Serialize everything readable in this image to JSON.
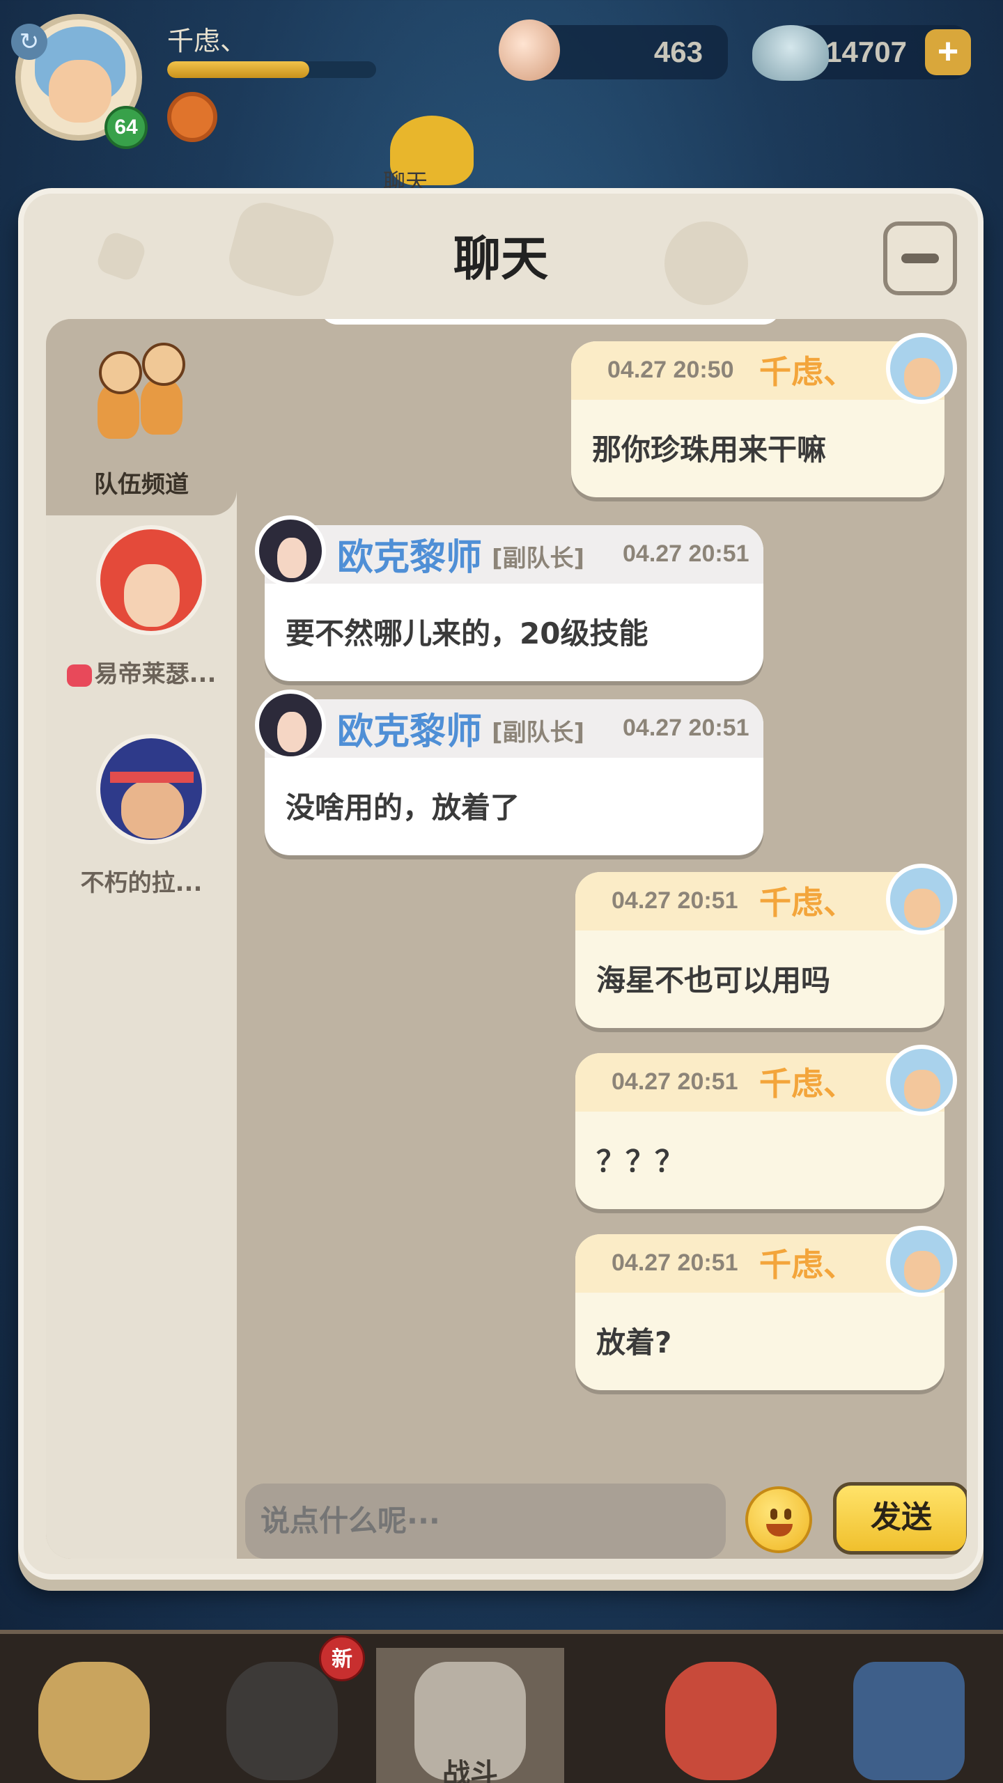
{
  "hud": {
    "player_name": "千虑、",
    "level": "64",
    "xp_progress": 0.68,
    "pearls": "463",
    "shells": "14707",
    "plus_label": "+",
    "background_chat_label": "聊天"
  },
  "chat": {
    "title": "聊天",
    "channels": [
      {
        "label": "队伍频道",
        "active": true,
        "icon": "team-icon"
      },
      {
        "label": "易帝莱瑟...",
        "active": false,
        "icon": "heart-icon"
      },
      {
        "label": "不朽的拉...",
        "active": false,
        "icon": ""
      }
    ],
    "messages": [
      {
        "side": "mine",
        "time": "04.27 20:50",
        "name": "千虑、",
        "text": "那你珍珠用来干嘛"
      },
      {
        "side": "theirs",
        "time": "04.27 20:51",
        "name": "欧克黎师",
        "role": "[副队长]",
        "text": "要不然哪儿来的，20级技能"
      },
      {
        "side": "theirs",
        "time": "04.27 20:51",
        "name": "欧克黎师",
        "role": "[副队长]",
        "text": "没啥用的，放着了"
      },
      {
        "side": "mine",
        "time": "04.27 20:51",
        "name": "千虑、",
        "text": "海星不也可以用吗"
      },
      {
        "side": "mine",
        "time": "04.27 20:51",
        "name": "千虑、",
        "text": "？？？"
      },
      {
        "side": "mine",
        "time": "04.27 20:51",
        "name": "千虑、",
        "text": "放着?"
      }
    ],
    "input_placeholder": "说点什么呢···",
    "send_label": "发送"
  },
  "bottom_nav": {
    "badge_new": "新",
    "battle_label": "战斗"
  },
  "colors": {
    "panel_bg": "#e8e2d5",
    "content_bg": "#beb3a2",
    "my_name": "#f3a53b",
    "their_name": "#4f8fd6",
    "send_button": "#f0c02d"
  }
}
